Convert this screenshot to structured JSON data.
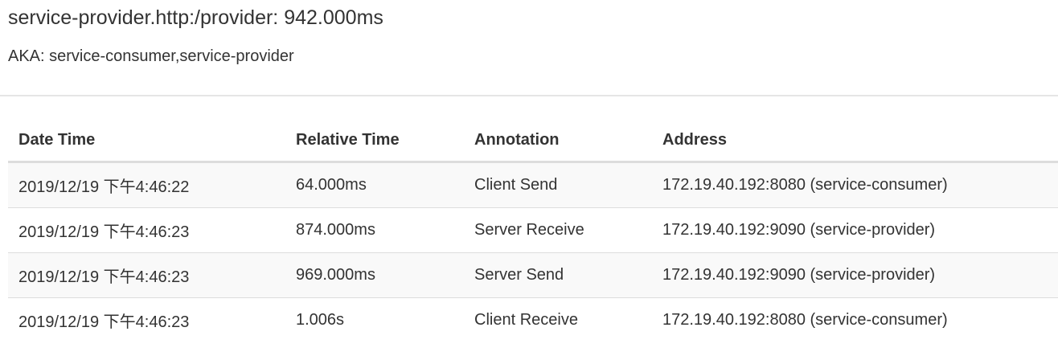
{
  "header": {
    "title": "service-provider.http:/provider: 942.000ms",
    "aka": "AKA: service-consumer,service-provider"
  },
  "table": {
    "columns": [
      "Date Time",
      "Relative Time",
      "Annotation",
      "Address"
    ],
    "rows": [
      {
        "date_time": "2019/12/19 下午4:46:22",
        "relative_time": "64.000ms",
        "annotation": "Client Send",
        "address": "172.19.40.192:8080 (service-consumer)"
      },
      {
        "date_time": "2019/12/19 下午4:46:23",
        "relative_time": "874.000ms",
        "annotation": "Server Receive",
        "address": "172.19.40.192:9090 (service-provider)"
      },
      {
        "date_time": "2019/12/19 下午4:46:23",
        "relative_time": "969.000ms",
        "annotation": "Server Send",
        "address": "172.19.40.192:9090 (service-provider)"
      },
      {
        "date_time": "2019/12/19 下午4:46:23",
        "relative_time": "1.006s",
        "annotation": "Client Receive",
        "address": "172.19.40.192:8080 (service-consumer)"
      }
    ]
  }
}
